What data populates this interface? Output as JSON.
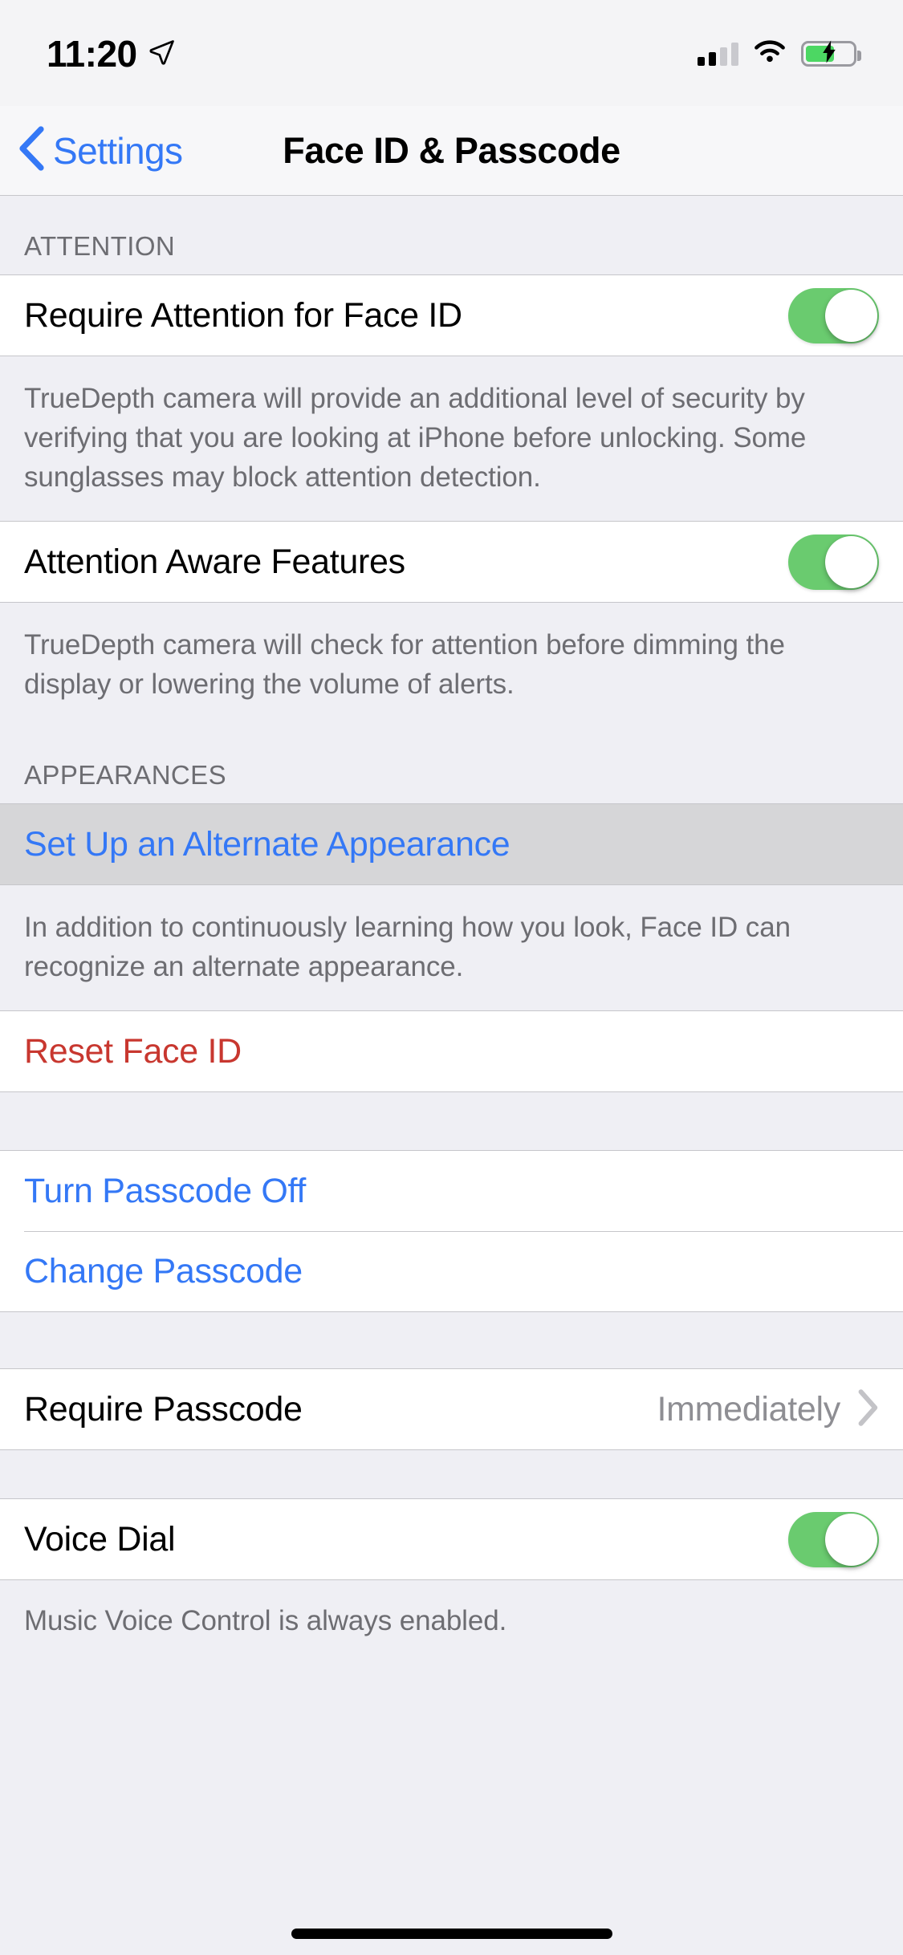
{
  "status_bar": {
    "time": "11:20",
    "location_icon": "location-arrow-icon",
    "signal_icon": "cellular-signal-icon",
    "signal_bars_total": 4,
    "signal_bars_active": 2,
    "wifi_icon": "wifi-icon",
    "battery_icon": "battery-charging-icon",
    "battery_level_percent": 62,
    "battery_charging": true
  },
  "nav_bar": {
    "back_label": "Settings",
    "back_icon": "chevron-left-icon",
    "title": "Face ID & Passcode"
  },
  "sections": {
    "attention": {
      "header": "ATTENTION",
      "rows": [
        {
          "label": "Require Attention for Face ID",
          "toggle": "on"
        },
        {
          "label": "Attention Aware Features",
          "toggle": "on"
        }
      ],
      "footer_1": "TrueDepth camera will provide an additional level of security by verifying that you are looking at iPhone before unlocking. Some sunglasses may block attention detection.",
      "footer_2": "TrueDepth camera will check for attention before dimming the display or lowering the volume of alerts."
    },
    "appearances": {
      "header": "APPEARANCES",
      "setup_label": "Set Up an Alternate Appearance",
      "footer": "In addition to continuously learning how you look, Face ID can recognize an alternate appearance."
    },
    "reset": {
      "label": "Reset Face ID"
    },
    "passcode": {
      "turn_off_label": "Turn Passcode Off",
      "change_label": "Change Passcode"
    },
    "require_passcode": {
      "label": "Require Passcode",
      "value": "Immediately",
      "disclosure_icon": "chevron-right-icon"
    },
    "voice_dial": {
      "label": "Voice Dial",
      "toggle": "on",
      "footer": "Music Voice Control is always enabled."
    }
  },
  "colors": {
    "accent_blue": "#3478F6",
    "destructive_red": "#C8372F",
    "toggle_on_green": "#6ACB6F",
    "group_background": "#EFEFF4",
    "cell_background": "#FFFFFF",
    "highlight_background": "#D6D6D8",
    "secondary_text": "#6D6D72",
    "value_text": "#8E8E93"
  },
  "home_indicator": "home-indicator"
}
